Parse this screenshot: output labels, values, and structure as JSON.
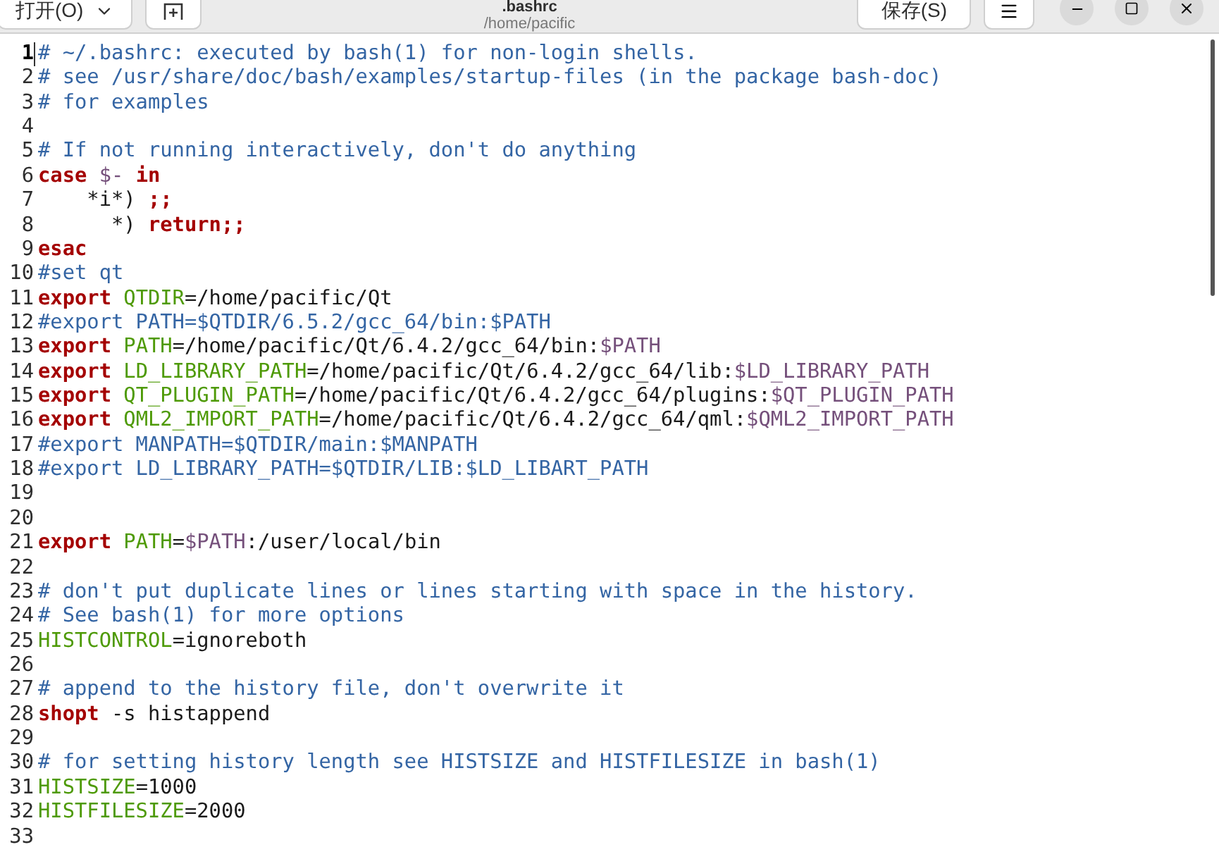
{
  "header": {
    "open_button": {
      "label": "打开(O)"
    },
    "title": ".bashrc",
    "subtitle": "/home/pacific",
    "save_button": {
      "label": "保存(S)"
    }
  },
  "editor": {
    "lines": [
      {
        "number": "1",
        "current": true,
        "tokens": [
          {
            "kind": "comment",
            "text": "# ~/.bashrc: executed by bash(1) for non-login shells."
          }
        ]
      },
      {
        "number": "2",
        "current": false,
        "tokens": [
          {
            "kind": "comment",
            "text": "# see /usr/share/doc/bash/examples/startup-files (in the package bash-doc)"
          }
        ]
      },
      {
        "number": "3",
        "current": false,
        "tokens": [
          {
            "kind": "comment",
            "text": "# for examples"
          }
        ]
      },
      {
        "number": "4",
        "current": false
      },
      {
        "number": "5",
        "current": false,
        "tokens": [
          {
            "kind": "comment",
            "text": "# If not running interactively, don't do anything"
          }
        ]
      },
      {
        "number": "6",
        "current": false,
        "tokens": [
          {
            "kind": "keyword",
            "text": "case "
          },
          {
            "kind": "ref",
            "text": "$- "
          },
          {
            "kind": "keyword",
            "text": "in"
          }
        ]
      },
      {
        "number": "7",
        "current": false,
        "tokens": [
          {
            "kind": "plain",
            "text": "    *i*) "
          },
          {
            "kind": "keyword",
            "text": ";;"
          }
        ]
      },
      {
        "number": "8",
        "current": false,
        "tokens": [
          {
            "kind": "plain",
            "text": "      *) "
          },
          {
            "kind": "keyword",
            "text": "return;;"
          }
        ]
      },
      {
        "number": "9",
        "current": false,
        "tokens": [
          {
            "kind": "keyword",
            "text": "esac"
          }
        ]
      },
      {
        "number": "10",
        "current": false,
        "tokens": [
          {
            "kind": "comment",
            "text": "#set qt"
          }
        ]
      },
      {
        "number": "11",
        "current": false,
        "tokens": [
          {
            "kind": "keyword",
            "text": "export "
          },
          {
            "kind": "var",
            "text": "QTDIR"
          },
          {
            "kind": "plain",
            "text": "=/home/pacific/Qt"
          }
        ]
      },
      {
        "number": "12",
        "current": false,
        "tokens": [
          {
            "kind": "comment",
            "text": "#export PATH=$QTDIR/6.5.2/gcc_64/bin:$PATH"
          }
        ]
      },
      {
        "number": "13",
        "current": false,
        "tokens": [
          {
            "kind": "keyword",
            "text": "export "
          },
          {
            "kind": "var",
            "text": "PATH"
          },
          {
            "kind": "plain",
            "text": "=/home/pacific/Qt/6.4.2/gcc_64/bin:"
          },
          {
            "kind": "ref",
            "text": "$PATH"
          }
        ]
      },
      {
        "number": "14",
        "current": false,
        "tokens": [
          {
            "kind": "keyword",
            "text": "export "
          },
          {
            "kind": "var",
            "text": "LD_LIBRARY_PATH"
          },
          {
            "kind": "plain",
            "text": "=/home/pacific/Qt/6.4.2/gcc_64/lib:"
          },
          {
            "kind": "ref",
            "text": "$LD_LIBRARY_PATH"
          }
        ]
      },
      {
        "number": "15",
        "current": false,
        "tokens": [
          {
            "kind": "keyword",
            "text": "export "
          },
          {
            "kind": "var",
            "text": "QT_PLUGIN_PATH"
          },
          {
            "kind": "plain",
            "text": "=/home/pacific/Qt/6.4.2/gcc_64/plugins:"
          },
          {
            "kind": "ref",
            "text": "$QT_PLUGIN_PATH"
          }
        ]
      },
      {
        "number": "16",
        "current": false,
        "tokens": [
          {
            "kind": "keyword",
            "text": "export "
          },
          {
            "kind": "var",
            "text": "QML2_IMPORT_PATH"
          },
          {
            "kind": "plain",
            "text": "=/home/pacific/Qt/6.4.2/gcc_64/qml:"
          },
          {
            "kind": "ref",
            "text": "$QML2_IMPORT_PATH"
          }
        ]
      },
      {
        "number": "17",
        "current": false,
        "tokens": [
          {
            "kind": "comment",
            "text": "#export MANPATH=$QTDIR/main:$MANPATH"
          }
        ]
      },
      {
        "number": "18",
        "current": false,
        "tokens": [
          {
            "kind": "comment",
            "text": "#export LD_LIBRARY_PATH=$QTDIR/LIB:$LD_LIBART_PATH"
          }
        ]
      },
      {
        "number": "19",
        "current": false
      },
      {
        "number": "20",
        "current": false
      },
      {
        "number": "21",
        "current": false,
        "tokens": [
          {
            "kind": "keyword",
            "text": "export "
          },
          {
            "kind": "var",
            "text": "PATH"
          },
          {
            "kind": "plain",
            "text": "="
          },
          {
            "kind": "ref",
            "text": "$PATH"
          },
          {
            "kind": "plain",
            "text": ":/user/local/bin"
          }
        ]
      },
      {
        "number": "22",
        "current": false
      },
      {
        "number": "23",
        "current": false,
        "tokens": [
          {
            "kind": "comment",
            "text": "# don't put duplicate lines or lines starting with space in the history."
          }
        ]
      },
      {
        "number": "24",
        "current": false,
        "tokens": [
          {
            "kind": "comment",
            "text": "# See bash(1) for more options"
          }
        ]
      },
      {
        "number": "25",
        "current": false,
        "tokens": [
          {
            "kind": "var",
            "text": "HISTCONTROL"
          },
          {
            "kind": "plain",
            "text": "=ignoreboth"
          }
        ]
      },
      {
        "number": "26",
        "current": false
      },
      {
        "number": "27",
        "current": false,
        "tokens": [
          {
            "kind": "comment",
            "text": "# append to the history file, don't overwrite it"
          }
        ]
      },
      {
        "number": "28",
        "current": false,
        "tokens": [
          {
            "kind": "keyword",
            "text": "shopt "
          },
          {
            "kind": "plain",
            "text": "-s histappend"
          }
        ]
      },
      {
        "number": "29",
        "current": false
      },
      {
        "number": "30",
        "current": false,
        "tokens": [
          {
            "kind": "comment",
            "text": "# for setting history length see HISTSIZE and HISTFILESIZE in bash(1)"
          }
        ]
      },
      {
        "number": "31",
        "current": false,
        "tokens": [
          {
            "kind": "var",
            "text": "HISTSIZE"
          },
          {
            "kind": "plain",
            "text": "=1000"
          }
        ]
      },
      {
        "number": "32",
        "current": false,
        "tokens": [
          {
            "kind": "var",
            "text": "HISTFILESIZE"
          },
          {
            "kind": "plain",
            "text": "=2000"
          }
        ]
      },
      {
        "number": "33",
        "current": false
      }
    ]
  }
}
